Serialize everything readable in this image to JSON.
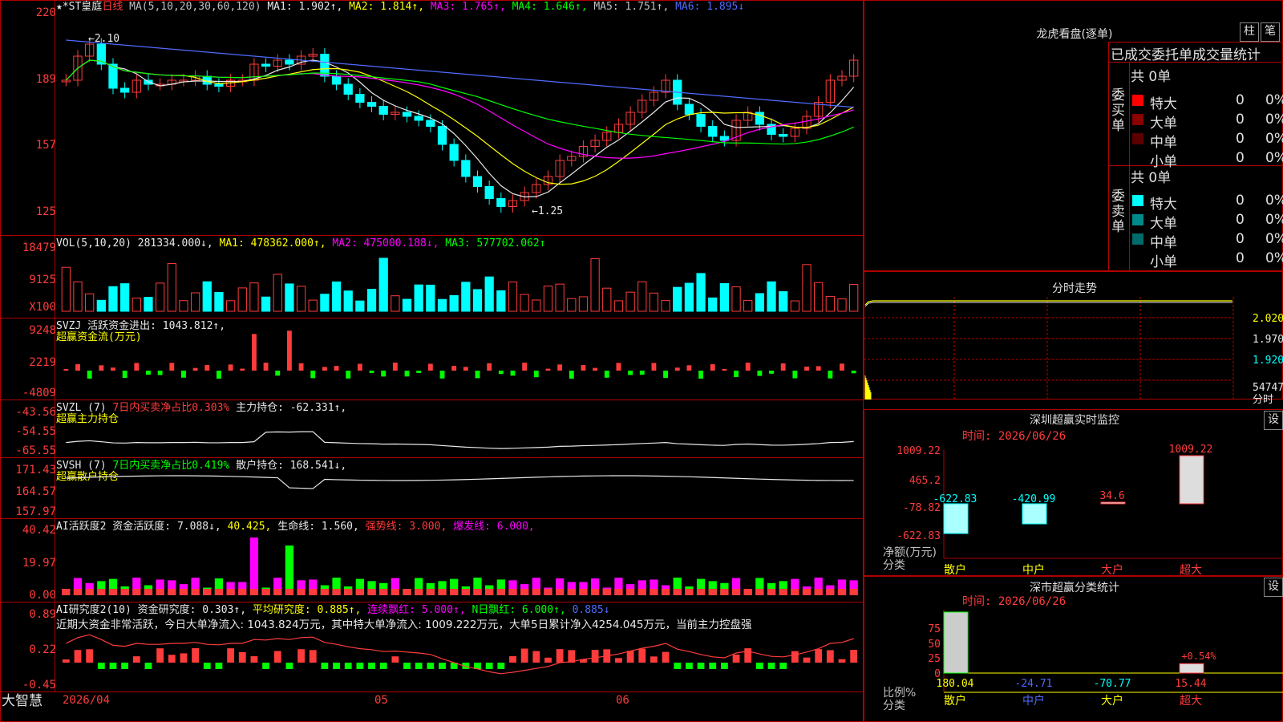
{
  "colors": {
    "up": "#ff3c3c",
    "down": "#00ffff",
    "grid": "#b00000",
    "ma1": "#e8e8e8",
    "ma2": "#ffff00",
    "ma3": "#ff00ff",
    "ma4": "#00ff00",
    "ma5": "#c0c0c0",
    "ma6": "#4f6bff"
  },
  "main": {
    "stock": "★*ST皇庭",
    "period": "日线",
    "ma_label": "MA(5,10,20,30,60,120)",
    "ma1": "MA1: 1.902↑,",
    "ma2": "MA2: 1.814↑,",
    "ma3": "MA3: 1.765↑,",
    "ma4": "MA4: 1.646↑,",
    "ma5": "MA5: 1.751↑,",
    "ma6": "MA6: 1.895↓",
    "high_mark": "2.10",
    "low_mark": "1.25",
    "axis": [
      "220",
      "189",
      "157",
      "125"
    ]
  },
  "vol": {
    "label": "VOL(5,10,20)",
    "v": "281334.000↓,",
    "ma1": "MA1: 478362.000↑,",
    "ma2": "MA2: 475000.188↓,",
    "ma3": "MA3: 577702.062↑",
    "axis": [
      "18479",
      "9125",
      "X100"
    ]
  },
  "svzj": {
    "l1": "SVZJ  活跃资金进出: 1043.812↑,",
    "l2": "超赢资金流(万元)",
    "axis": [
      "9248",
      "2219",
      "-4809"
    ]
  },
  "svzl": {
    "a": "SVZL (7) ",
    "b": "7日内买卖净占比0.303%",
    "c": " 主力持仓: -62.331↑,",
    "l2": "超赢主力持仓",
    "axis": [
      "-43.56",
      "-54.55",
      "-65.55"
    ]
  },
  "svsh": {
    "a": "SVSH (7) ",
    "b": "7日内买卖净占比0.419%",
    "c": " 散户持仓: 168.541↓,",
    "l2": "超赢散户持仓",
    "axis": [
      "171.43",
      "164.57",
      "157.97"
    ]
  },
  "ai1": {
    "a": "AI活跃度2 资金活跃度: 7.088↓,",
    "b": "40.425,",
    "c": "生命线: 1.560,",
    "d": "强势线: 3.000,",
    "e": "爆发线: 6.000,",
    "axis": [
      "40.42",
      "19.97",
      "0.00"
    ]
  },
  "ai2": {
    "a": "AI研究度2(10) 资金研究度: 0.303↑,",
    "b": "平均研究度: 0.885↑,",
    "c": "连续飘红: 5.000↑,",
    "d": "N日飘红: 6.000↑,",
    "e": "0.885↓",
    "l2": "近期大资金非常活跃，今日大单净流入: 1043.824万元，其中特大单净流入: 1009.222万元，大单5日累计净入4254.045万元，当前主力控盘强",
    "axis": [
      "0.89",
      "0.22",
      "-0.45"
    ]
  },
  "bottom": {
    "brand": "大智慧",
    "date": "2026/04",
    "m5": "05",
    "m6": "06"
  },
  "lhb": {
    "title": "龙虎看盘(逐单)",
    "btn1": "柱",
    "btn2": "笔",
    "tabs": "已成交委托单成交量统计",
    "buy_label": "委买单",
    "sell_label": "委卖单",
    "buy_total": "共 0单",
    "sell_total": "共 0单",
    "rows": [
      {
        "name": "特大",
        "n": "0",
        "p": "0%"
      },
      {
        "name": "大单",
        "n": "0",
        "p": "0%"
      },
      {
        "name": "中单",
        "n": "0",
        "p": "0%"
      },
      {
        "name": "小单",
        "n": "0",
        "p": "0%"
      }
    ],
    "buy_colors": [
      "#ff0000",
      "#8b0000",
      "#5a0000"
    ],
    "sell_colors": [
      "#00ffff",
      "#008b8b",
      "#006b6b"
    ]
  },
  "fs": {
    "title": "分时走势",
    "axis": [
      "2.020",
      "1.970",
      "1.920",
      "54747",
      "分时"
    ]
  },
  "sz": {
    "title": "深圳超赢实时监控",
    "btn": "设",
    "time": "时间: 2026/06/26",
    "axis": [
      "1009.22",
      "465.2",
      "-78.82",
      "-622.83"
    ],
    "ylab1": "净额(万元)",
    "ylab2": "分类",
    "bars": [
      {
        "name": "散户",
        "val": "-622.83",
        "v": -622.83
      },
      {
        "name": "中户",
        "val": "-420.99",
        "v": -420.99
      },
      {
        "name": "大户",
        "val": "34.6",
        "v": 34.6
      },
      {
        "name": "超大",
        "val": "1009.22",
        "v": 1009.22
      }
    ]
  },
  "cls": {
    "title": "深市超赢分类统计",
    "btn": "设",
    "time": "时间: 2026/06/26",
    "axis": [
      "75",
      "50",
      "25",
      "0"
    ],
    "ylab1": "比例%",
    "ylab2": "分类",
    "bars": [
      {
        "name": "散户",
        "val": "180.04",
        "v": 100
      },
      {
        "name": "中户",
        "val": "-24.71",
        "v": 0
      },
      {
        "name": "大户",
        "val": "-70.77",
        "v": 0
      },
      {
        "name": "超大",
        "val": "15.44",
        "v": 15.44
      }
    ],
    "pct": "+0.54%"
  }
}
